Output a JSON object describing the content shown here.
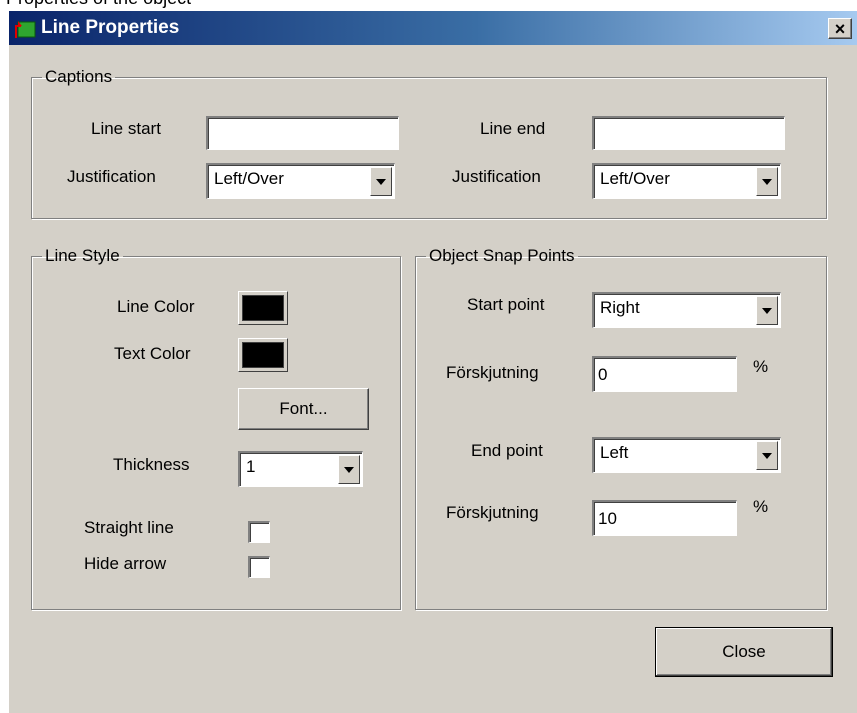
{
  "clipped_header": "Properties of the object",
  "window": {
    "title": "Line Properties",
    "close_glyph": "×"
  },
  "captions": {
    "title": "Captions",
    "line_start_label": "Line start",
    "line_start_value": "",
    "line_end_label": "Line end",
    "line_end_value": "",
    "justification_label": "Justification",
    "start_justification": "Left/Over",
    "end_justification": "Left/Over"
  },
  "line_style": {
    "title": "Line Style",
    "line_color_label": "Line Color",
    "line_color": "#000000",
    "text_color_label": "Text Color",
    "text_color": "#000000",
    "font_button": "Font...",
    "thickness_label": "Thickness",
    "thickness_value": "1",
    "straight_line_label": "Straight line",
    "straight_line_checked": false,
    "hide_arrow_label": "Hide arrow",
    "hide_arrow_checked": false
  },
  "snap_points": {
    "title": "Object Snap Points",
    "start_point_label": "Start point",
    "start_point_value": "Right",
    "start_offset_label": "Förskjutning",
    "start_offset_value": "0",
    "start_offset_unit": "%",
    "end_point_label": "End point",
    "end_point_value": "Left",
    "end_offset_label": "Förskjutning",
    "end_offset_value": "10",
    "end_offset_unit": "%"
  },
  "close_button": "Close"
}
